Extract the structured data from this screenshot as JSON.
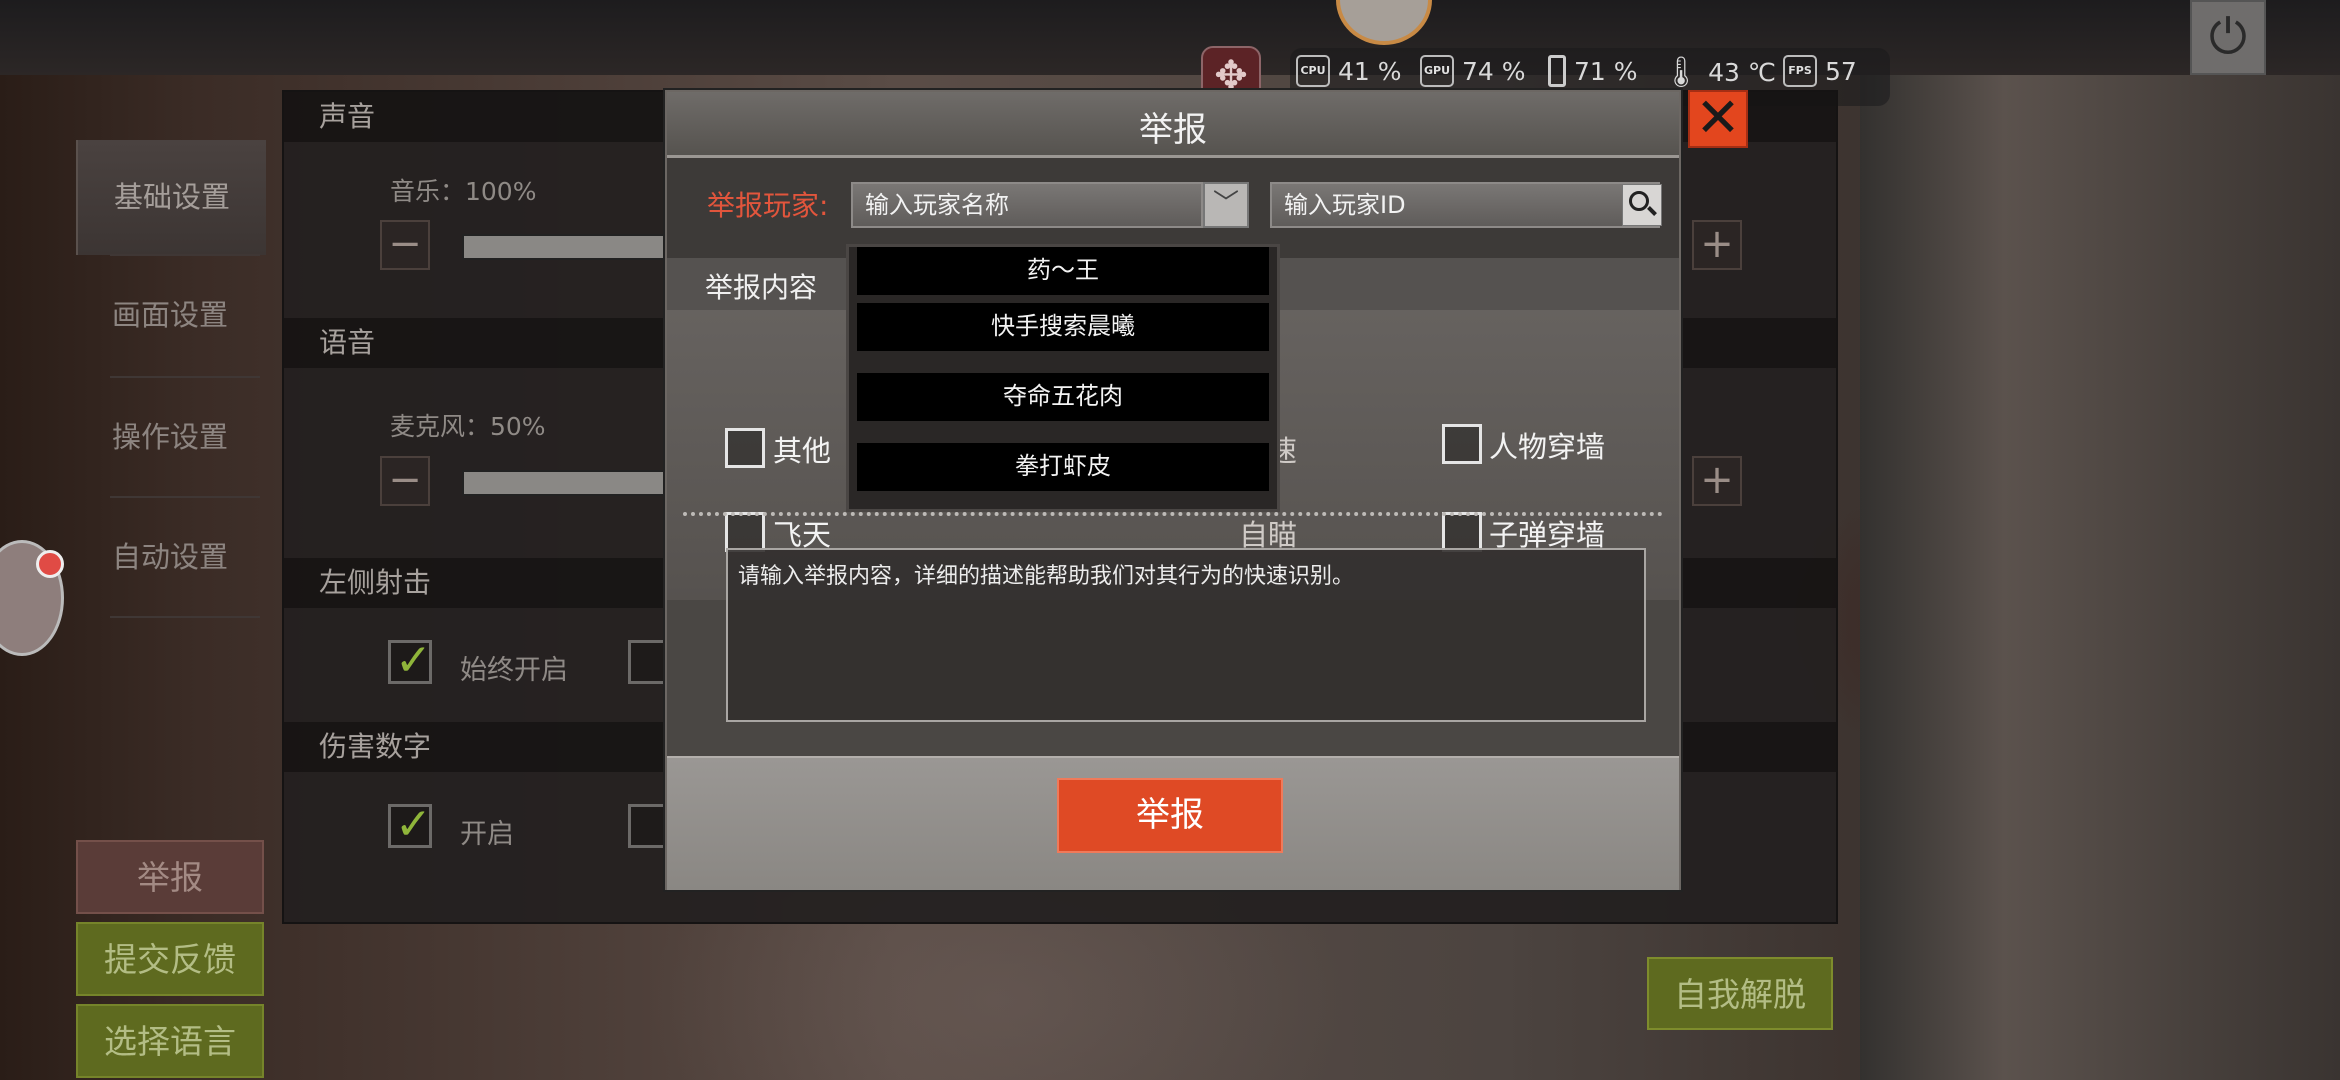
{
  "hud": {
    "cpu_icon": "CPU",
    "cpu": "41 %",
    "gpu_icon": "GPU",
    "gpu": "74 %",
    "battery": "71 %",
    "temp": "43 ℃",
    "fps_icon": "FPS",
    "fps": "57"
  },
  "settings": {
    "nav": [
      "基础设置",
      "画面设置",
      "操作设置",
      "自动设置"
    ],
    "sections": [
      "声音",
      "语音",
      "左侧射击",
      "伤害数字"
    ],
    "music_label": "音乐：100%",
    "mic_label": "麦克风：50%",
    "always_on": "始终开启",
    "on": "开启"
  },
  "side_buttons": {
    "report": "举报",
    "feedback": "提交反馈",
    "language": "选择语言",
    "self_rescue": "自我解脱"
  },
  "dialog": {
    "title": "举报",
    "player_label": "举报玩家:",
    "name_placeholder": "输入玩家名称",
    "id_placeholder": "输入玩家ID",
    "content_label": "举报内容",
    "options": [
      "其他",
      "飞天",
      "加速",
      "自瞄",
      "人物穿墙",
      "子弹穿墙"
    ],
    "textarea_placeholder": "请输入举报内容，详细的描述能帮助我们对其行为的快速识别。",
    "submit": "举报"
  },
  "dropdown": {
    "items": [
      "药～王",
      "快手搜索晨曦",
      "夺命五花肉",
      "拳打虾皮"
    ]
  },
  "colors": {
    "accent_red": "#df4a25",
    "label_red": "#e2553c",
    "green_button": "#5e6a1f",
    "close_red": "#e3461e"
  },
  "icons": [
    "move-icon",
    "power-icon",
    "close-icon",
    "search-icon",
    "chevron-down-icon",
    "battery-icon",
    "thermometer-icon",
    "check-icon"
  ]
}
